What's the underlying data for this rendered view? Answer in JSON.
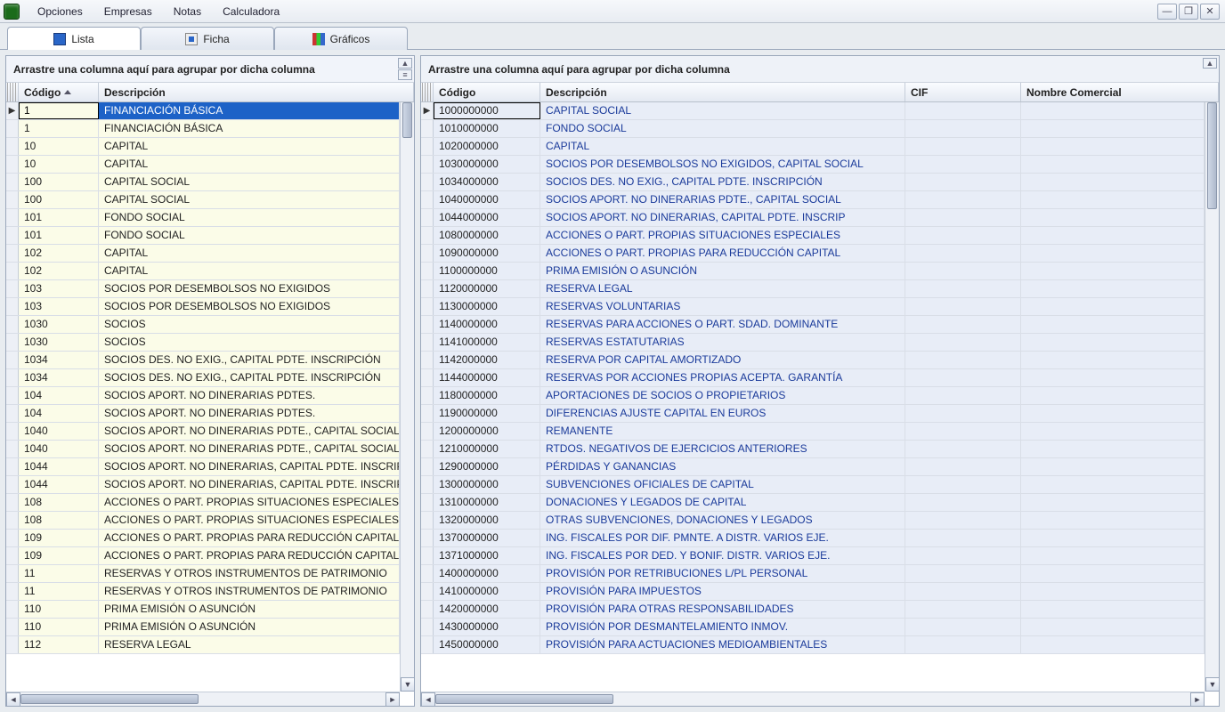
{
  "menu": {
    "items": [
      "Opciones",
      "Empresas",
      "Notas",
      "Calculadora"
    ]
  },
  "tabs": [
    {
      "label": "Lista",
      "active": true
    },
    {
      "label": "Ficha",
      "active": false
    },
    {
      "label": "Gráficos",
      "active": false
    }
  ],
  "group_hint": "Arrastre una columna aquí para agrupar por dicha columna",
  "left": {
    "columns": {
      "codigo": "Código",
      "desc": "Descripción"
    },
    "rows": [
      {
        "codigo": "1",
        "desc": "FINANCIACIÓN BÁSICA",
        "selected": true,
        "indicator": true
      },
      {
        "codigo": "1",
        "desc": "FINANCIACIÓN BÁSICA"
      },
      {
        "codigo": "10",
        "desc": "CAPITAL"
      },
      {
        "codigo": "10",
        "desc": "CAPITAL"
      },
      {
        "codigo": "100",
        "desc": "CAPITAL SOCIAL"
      },
      {
        "codigo": "100",
        "desc": "CAPITAL SOCIAL"
      },
      {
        "codigo": "101",
        "desc": "FONDO SOCIAL"
      },
      {
        "codigo": "101",
        "desc": "FONDO SOCIAL"
      },
      {
        "codigo": "102",
        "desc": "CAPITAL"
      },
      {
        "codigo": "102",
        "desc": "CAPITAL"
      },
      {
        "codigo": "103",
        "desc": "SOCIOS POR DESEMBOLSOS NO EXIGIDOS"
      },
      {
        "codigo": "103",
        "desc": "SOCIOS POR DESEMBOLSOS NO EXIGIDOS"
      },
      {
        "codigo": "1030",
        "desc": "SOCIOS"
      },
      {
        "codigo": "1030",
        "desc": "SOCIOS"
      },
      {
        "codigo": "1034",
        "desc": "SOCIOS DES. NO EXIG., CAPITAL PDTE. INSCRIPCIÓN"
      },
      {
        "codigo": "1034",
        "desc": "SOCIOS DES. NO EXIG., CAPITAL PDTE. INSCRIPCIÓN"
      },
      {
        "codigo": "104",
        "desc": "SOCIOS APORT. NO DINERARIAS PDTES."
      },
      {
        "codigo": "104",
        "desc": "SOCIOS APORT. NO DINERARIAS PDTES."
      },
      {
        "codigo": "1040",
        "desc": "SOCIOS APORT. NO DINERARIAS PDTE., CAPITAL SOCIAL"
      },
      {
        "codigo": "1040",
        "desc": "SOCIOS APORT. NO DINERARIAS PDTE., CAPITAL SOCIAL"
      },
      {
        "codigo": "1044",
        "desc": "SOCIOS APORT. NO DINERARIAS, CAPITAL PDTE. INSCRIP"
      },
      {
        "codigo": "1044",
        "desc": "SOCIOS APORT. NO DINERARIAS, CAPITAL PDTE. INSCRIP"
      },
      {
        "codigo": "108",
        "desc": "ACCIONES O PART. PROPIAS SITUACIONES ESPECIALES"
      },
      {
        "codigo": "108",
        "desc": "ACCIONES O PART. PROPIAS SITUACIONES ESPECIALES"
      },
      {
        "codigo": "109",
        "desc": "ACCIONES O PART. PROPIAS PARA REDUCCIÓN CAPITAL"
      },
      {
        "codigo": "109",
        "desc": "ACCIONES O PART. PROPIAS PARA REDUCCIÓN CAPITAL"
      },
      {
        "codigo": "11",
        "desc": "RESERVAS Y OTROS INSTRUMENTOS DE PATRIMONIO"
      },
      {
        "codigo": "11",
        "desc": "RESERVAS Y OTROS INSTRUMENTOS DE PATRIMONIO"
      },
      {
        "codigo": "110",
        "desc": "PRIMA EMISIÓN O ASUNCIÓN"
      },
      {
        "codigo": "110",
        "desc": "PRIMA EMISIÓN O ASUNCIÓN"
      },
      {
        "codigo": "112",
        "desc": "RESERVA LEGAL"
      }
    ]
  },
  "right": {
    "columns": {
      "codigo": "Código",
      "desc": "Descripción",
      "cif": "CIF",
      "nombre": "Nombre Comercial"
    },
    "rows": [
      {
        "codigo": "1000000000",
        "desc": "CAPITAL SOCIAL",
        "indicator": true
      },
      {
        "codigo": "1010000000",
        "desc": "FONDO SOCIAL"
      },
      {
        "codigo": "1020000000",
        "desc": "CAPITAL"
      },
      {
        "codigo": "1030000000",
        "desc": "SOCIOS POR DESEMBOLSOS NO EXIGIDOS, CAPITAL SOCIAL"
      },
      {
        "codigo": "1034000000",
        "desc": "SOCIOS DES. NO EXIG., CAPITAL PDTE. INSCRIPCIÓN"
      },
      {
        "codigo": "1040000000",
        "desc": "SOCIOS APORT. NO DINERARIAS PDTE., CAPITAL SOCIAL"
      },
      {
        "codigo": "1044000000",
        "desc": "SOCIOS APORT. NO DINERARIAS, CAPITAL PDTE. INSCRIP"
      },
      {
        "codigo": "1080000000",
        "desc": "ACCIONES O PART. PROPIAS SITUACIONES ESPECIALES"
      },
      {
        "codigo": "1090000000",
        "desc": "ACCIONES O PART. PROPIAS PARA REDUCCIÓN CAPITAL"
      },
      {
        "codigo": "1100000000",
        "desc": "PRIMA EMISIÓN O ASUNCIÓN"
      },
      {
        "codigo": "1120000000",
        "desc": "RESERVA LEGAL"
      },
      {
        "codigo": "1130000000",
        "desc": "RESERVAS VOLUNTARIAS"
      },
      {
        "codigo": "1140000000",
        "desc": "RESERVAS PARA ACCIONES O PART. SDAD. DOMINANTE"
      },
      {
        "codigo": "1141000000",
        "desc": "RESERVAS ESTATUTARIAS"
      },
      {
        "codigo": "1142000000",
        "desc": "RESERVA POR CAPITAL AMORTIZADO"
      },
      {
        "codigo": "1144000000",
        "desc": "RESERVAS POR ACCIONES PROPIAS ACEPTA. GARANTÍA"
      },
      {
        "codigo": "1180000000",
        "desc": "APORTACIONES DE SOCIOS O PROPIETARIOS"
      },
      {
        "codigo": "1190000000",
        "desc": "DIFERENCIAS AJUSTE CAPITAL EN EUROS"
      },
      {
        "codigo": "1200000000",
        "desc": "REMANENTE"
      },
      {
        "codigo": "1210000000",
        "desc": "RTDOS. NEGATIVOS DE EJERCICIOS ANTERIORES"
      },
      {
        "codigo": "1290000000",
        "desc": "PÉRDIDAS Y GANANCIAS"
      },
      {
        "codigo": "1300000000",
        "desc": "SUBVENCIONES OFICIALES DE CAPITAL"
      },
      {
        "codigo": "1310000000",
        "desc": "DONACIONES Y LEGADOS DE CAPITAL"
      },
      {
        "codigo": "1320000000",
        "desc": "OTRAS SUBVENCIONES, DONACIONES Y LEGADOS"
      },
      {
        "codigo": "1370000000",
        "desc": "ING. FISCALES POR DIF. PMNTE. A DISTR. VARIOS EJE."
      },
      {
        "codigo": "1371000000",
        "desc": "ING. FISCALES POR DED. Y BONIF. DISTR. VARIOS EJE."
      },
      {
        "codigo": "1400000000",
        "desc": "PROVISIÓN POR RETRIBUCIONES L/PL PERSONAL"
      },
      {
        "codigo": "1410000000",
        "desc": "PROVISIÓN PARA IMPUESTOS"
      },
      {
        "codigo": "1420000000",
        "desc": "PROVISIÓN PARA OTRAS RESPONSABILIDADES"
      },
      {
        "codigo": "1430000000",
        "desc": "PROVISIÓN POR DESMANTELAMIENTO INMOV."
      },
      {
        "codigo": "1450000000",
        "desc": "PROVISIÓN PARA ACTUACIONES MEDIOAMBIENTALES"
      }
    ]
  }
}
